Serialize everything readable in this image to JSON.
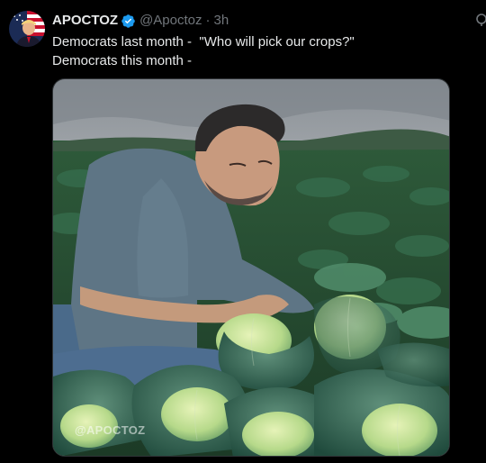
{
  "post": {
    "author": {
      "display_name": "APOCTOZ",
      "handle": "@Apoctoz",
      "verified_icon": "verified-badge-icon",
      "avatar_icon": "avatar-image"
    },
    "separator": "·",
    "time": "3h",
    "text_line_1": "Democrats last month -  \"Who will pick our crops?\"",
    "text_line_2": "Democrats this month -",
    "media": {
      "description_icon": "photo-man-in-cabbage-field",
      "watermark": "@APOCTOZ"
    },
    "more_icon": "more-options-icon"
  },
  "colors": {
    "background": "#000000",
    "text_primary": "#e7e9ea",
    "text_secondary": "#71767b",
    "verified_blue": "#1d9bf0",
    "media_border": "#2f3336"
  }
}
